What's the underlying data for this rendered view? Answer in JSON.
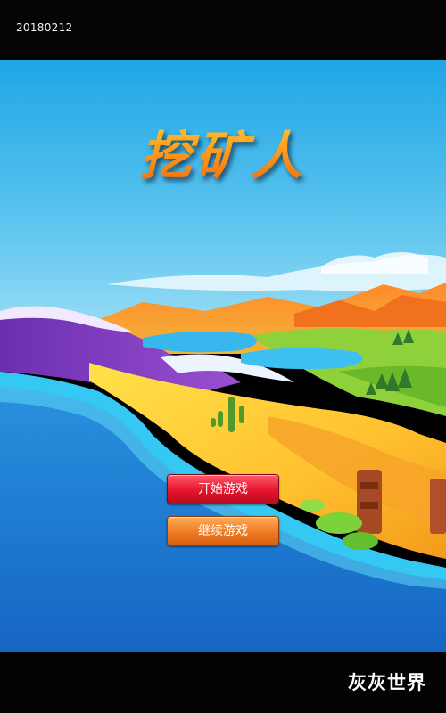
{
  "status": {
    "build_id": "20180212"
  },
  "title": {
    "text": "挖矿人"
  },
  "menu": {
    "start_label": "开始游戏",
    "continue_label": "继续游戏"
  },
  "footer": {
    "brand_label": "灰灰世界"
  },
  "colors": {
    "start_button": "#e3142c",
    "continue_button": "#ef7a22",
    "title_gradient_top": "#ffd23a",
    "title_gradient_bottom": "#f06a0c",
    "sky": "#3fb5e8",
    "sea": "#1f83d8"
  }
}
